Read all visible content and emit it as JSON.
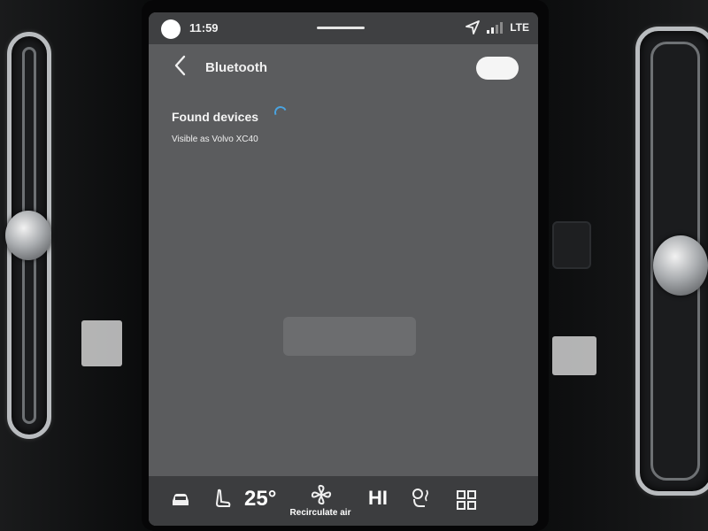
{
  "status_bar": {
    "time": "11:59",
    "network": "LTE"
  },
  "header": {
    "title": "Bluetooth",
    "toggle_on": true
  },
  "content": {
    "section_title": "Found devices",
    "visible_as": "Visible as Volvo XC40"
  },
  "climate_bar": {
    "temperature": "25°",
    "recirculate_label": "Recirculate air",
    "fan_level": "HI"
  },
  "icons": {
    "status_dot": "home-dot-icon",
    "location": "navigation-arrow-icon",
    "signal": "signal-bars-icon",
    "back": "chevron-left-icon",
    "spinner": "loading-spinner-icon",
    "car": "car-icon",
    "seat": "seat-icon",
    "fan": "fan-icon",
    "seat_heat": "seat-heat-icon",
    "apps": "app-grid-icon"
  },
  "colors": {
    "screen_bg": "#5b5c5e",
    "status_bar_bg": "#3f4042",
    "climate_bar_bg": "#3c3d3f",
    "spinner_accent": "#4aa3df",
    "text": "#f0f0f0"
  }
}
